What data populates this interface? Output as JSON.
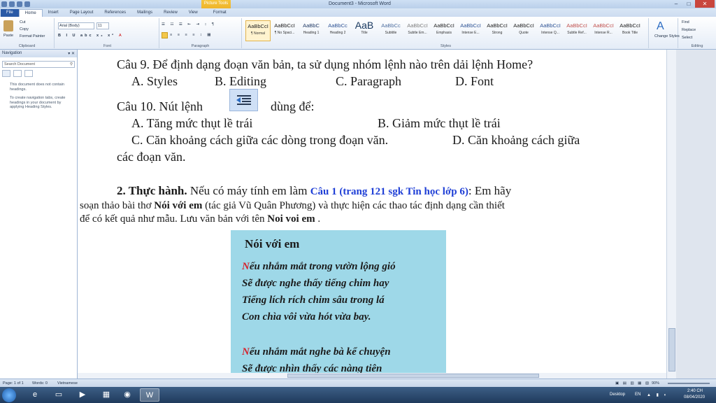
{
  "window": {
    "title": "Document3 - Microsoft Word",
    "context_tab": {
      "group": "Picture Tools",
      "tab": "Format"
    }
  },
  "tabs": [
    "File",
    "Home",
    "Insert",
    "Page Layout",
    "References",
    "Mailings",
    "Review",
    "View"
  ],
  "ribbon": {
    "clipboard": {
      "paste": "Paste",
      "cut": "Cut",
      "copy": "Copy",
      "format_painter": "Format Painter",
      "label": "Clipboard"
    },
    "font": {
      "name": "Arial (Body)",
      "size": "11",
      "label": "Font"
    },
    "paragraph": {
      "label": "Paragraph"
    },
    "styles": {
      "label": "Styles",
      "items": [
        {
          "sample": "AaBbCcI",
          "name": "¶ Normal"
        },
        {
          "sample": "AaBbCcI",
          "name": "¶ No Spaci..."
        },
        {
          "sample": "AaBbC",
          "name": "Heading 1"
        },
        {
          "sample": "AaBbCc",
          "name": "Heading 2"
        },
        {
          "sample": "AaB",
          "name": "Title"
        },
        {
          "sample": "AaBbCc",
          "name": "Subtitle"
        },
        {
          "sample": "AaBbCcI",
          "name": "Subtle Em..."
        },
        {
          "sample": "AaBbCcI",
          "name": "Emphasis"
        },
        {
          "sample": "AaBbCcI",
          "name": "Intense E..."
        },
        {
          "sample": "AaBbCcI",
          "name": "Strong"
        },
        {
          "sample": "AaBbCcI",
          "name": "Quote"
        },
        {
          "sample": "AaBbCcI",
          "name": "Intense Q..."
        },
        {
          "sample": "AaBbCcI",
          "name": "Subtle Ref..."
        },
        {
          "sample": "AaBbCcI",
          "name": "Intense R..."
        },
        {
          "sample": "AaBbCcI",
          "name": "Book Title"
        }
      ],
      "change_styles": "Change Styles"
    },
    "editing": {
      "find": "Find",
      "replace": "Replace",
      "select": "Select",
      "label": "Editing"
    }
  },
  "navigation": {
    "title": "Navigation",
    "search_placeholder": "Search Document",
    "msg1": "This document does not contain headings.",
    "msg2": "To create navigation tabs, create headings in your document by applying Heading Styles."
  },
  "document": {
    "q9": "Câu 9. Để định dạng đoạn văn bản, ta sử dụng nhóm lệnh nào trên dải lệnh Home?",
    "q9_a": "A. Styles",
    "q9_b": "B. Editing",
    "q9_c": "C. Paragraph",
    "q9_d": "D. Font",
    "q10_pre": "Câu 10. Nút lệnh",
    "q10_post": "dùng để:",
    "q10_a": "A. Tăng mức thụt lề trái",
    "q10_b": "B. Giảm mức thụt lề trái",
    "q10_c": "C. Căn khoảng cách giữa các dòng trong đoạn văn.",
    "q10_d": "D. Căn khoảng cách giữa",
    "q10_d2": "các đoạn văn.",
    "practice_title": "2. Thực hành.",
    "practice_text1": " Nếu có máy tính em làm ",
    "practice_link": "Câu 1 (trang 121 sgk Tin học lớp 6)",
    "practice_text2": ": Em hãy",
    "practice_line2_pre": "soạn thảo bài thơ ",
    "practice_poem_name": "Nói với em",
    "practice_line2_post": " (tác giả Vũ Quân Phương) và thực hiện các thao tác định dạng cần thiết",
    "practice_line3_pre": "để có kết quả như mẫu. Lưu văn bản với tên ",
    "practice_file": "Noi voi em",
    "practice_line3_post": " .",
    "poem": {
      "title": "Nói với em",
      "lines": [
        {
          "cap": "N",
          "rest": "ếu nhắm mắt trong vườn lộng gió"
        },
        {
          "cap": "",
          "rest": "Sẽ được nghe thấy tiếng chim hay"
        },
        {
          "cap": "",
          "rest": "Tiếng lích rích chim sâu trong lá"
        },
        {
          "cap": "",
          "rest": "Con chìa vôi vừa hót vừa bay."
        },
        {
          "cap": "N",
          "rest": "ếu nhắm mắt nghe bà kể chuyện"
        },
        {
          "cap": "",
          "rest": "Sẽ được nhìn thấy các nàng tiên"
        }
      ]
    }
  },
  "status": {
    "page": "Page: 1 of 1",
    "words": "Words: 0",
    "language": "Vietnamese",
    "zoom": "90%"
  },
  "taskbar": {
    "desktop": "Desktop",
    "lang": "EN",
    "time": "2:40 CH",
    "date": "08/04/2020"
  }
}
